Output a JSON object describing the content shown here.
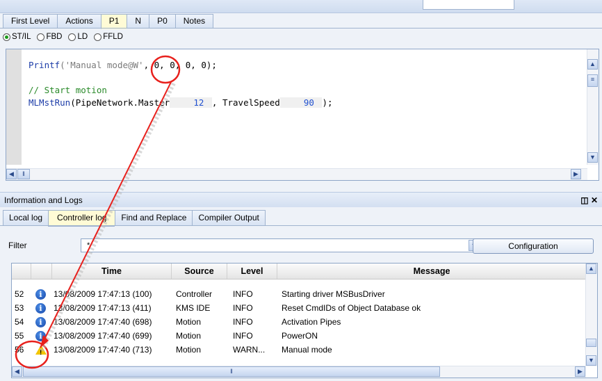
{
  "top_tabs": [
    "First Level",
    "Actions",
    "P1",
    "N",
    "P0",
    "Notes"
  ],
  "active_top_tab": "P1",
  "languages": [
    {
      "label": "ST/IL",
      "selected": true
    },
    {
      "label": "FBD",
      "selected": false
    },
    {
      "label": "LD",
      "selected": false
    },
    {
      "label": "FFLD",
      "selected": false
    }
  ],
  "code": {
    "line1_fn": "Printf",
    "line1_str": "('Manual mode@W'",
    "line1_rest": ", 0, 0, 0, 0);",
    "comment": "// Start motion",
    "line3_fn": "MLMstRun",
    "line3_a": "(PipeNetwork.Master",
    "line3_v1": "12",
    "line3_b": ", TravelSpeed",
    "line3_v2": "90",
    "line3_c": ");"
  },
  "panel": {
    "title": "Information and Logs",
    "tabs": [
      "Local log",
      "Controller log",
      "Find and Replace",
      "Compiler Output"
    ],
    "active_tab": "Controller log",
    "filter_label": "Filter",
    "filter_value": "*",
    "config_label": "Configuration"
  },
  "log": {
    "headers": {
      "time": "Time",
      "source": "Source",
      "level": "Level",
      "message": "Message"
    },
    "rows": [
      {
        "num": "52",
        "icon": "info-icon",
        "time": "13/08/2009 17:47:13 (100)",
        "source": "Controller",
        "level": "INFO",
        "message": "Starting driver MSBusDriver"
      },
      {
        "num": "53",
        "icon": "info-icon",
        "time": "13/08/2009 17:47:13 (411)",
        "source": "KMS IDE",
        "level": "INFO",
        "message": "Reset CmdIDs of Object Database ok"
      },
      {
        "num": "54",
        "icon": "info-icon",
        "time": "13/08/2009 17:47:40 (698)",
        "source": "Motion",
        "level": "INFO",
        "message": "Activation Pipes"
      },
      {
        "num": "55",
        "icon": "info-icon",
        "time": "13/08/2009 17:47:40 (699)",
        "source": "Motion",
        "level": "INFO",
        "message": "PowerON"
      },
      {
        "num": "56",
        "icon": "warning-icon",
        "time": "13/08/2009 17:47:40 (713)",
        "source": "Motion",
        "level": "WARN...",
        "message": "Manual mode"
      }
    ]
  },
  "colors": {
    "active_tab": "#fffbd6",
    "annotation": "#e8201c"
  }
}
